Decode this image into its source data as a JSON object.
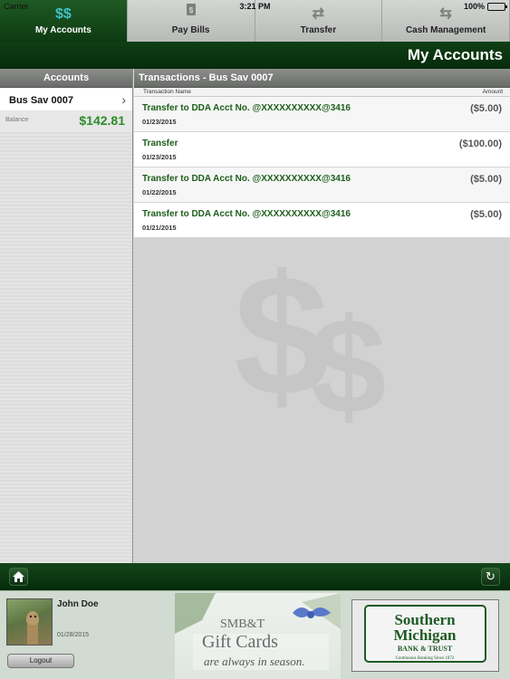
{
  "status_bar": {
    "carrier": "Carrier",
    "time": "3:21 PM",
    "battery": "100%"
  },
  "tabs": [
    {
      "label": "My Accounts",
      "icon": "dollar-icon",
      "glyph": "$$",
      "active": true
    },
    {
      "label": "Pay Bills",
      "icon": "bill-icon",
      "glyph": "🧾",
      "active": false
    },
    {
      "label": "Transfer",
      "icon": "transfer-icon",
      "glyph": "⇄",
      "active": false
    },
    {
      "label": "Cash Management",
      "icon": "shuffle-icon",
      "glyph": "⇆",
      "active": false
    }
  ],
  "page_title": "My Accounts",
  "accounts_panel": {
    "header": "Accounts",
    "account": {
      "name": "Bus Sav 0007",
      "balance_label": "Balance",
      "balance": "$142.81"
    }
  },
  "transactions_panel": {
    "header": "Transactions - Bus Sav 0007",
    "col_name": "Transaction Name",
    "col_amount": "Amount",
    "rows": [
      {
        "name": "Transfer to DDA Acct No. @XXXXXXXXXX@3416",
        "date": "01/23/2015",
        "amount": "($5.00)"
      },
      {
        "name": "Transfer",
        "date": "01/23/2015",
        "amount": "($100.00)"
      },
      {
        "name": "Transfer to DDA Acct No. @XXXXXXXXXX@3416",
        "date": "01/22/2015",
        "amount": "($5.00)"
      },
      {
        "name": "Transfer to DDA Acct No. @XXXXXXXXXX@3416",
        "date": "01/21/2015",
        "amount": "($5.00)"
      }
    ]
  },
  "toolbar": {
    "home_icon": "home-icon",
    "refresh_icon": "refresh-icon"
  },
  "user": {
    "name": "John Doe",
    "date": "01/28/2015",
    "logout_label": "Logout"
  },
  "ads": {
    "gift": {
      "brand": "SMB&T",
      "title": "Gift Cards",
      "tagline": "are always in season."
    },
    "bank": {
      "name_line1": "Southern",
      "name_line2": "Michigan",
      "name_line3": "BANK & TRUST",
      "tagline": "Continuous Banking Since 1872"
    }
  },
  "colors": {
    "brand_green": "#0d3a12",
    "text_green": "#1c5e1a",
    "balance_green": "#2e8b2a",
    "active_icon": "#3fc1c9"
  }
}
